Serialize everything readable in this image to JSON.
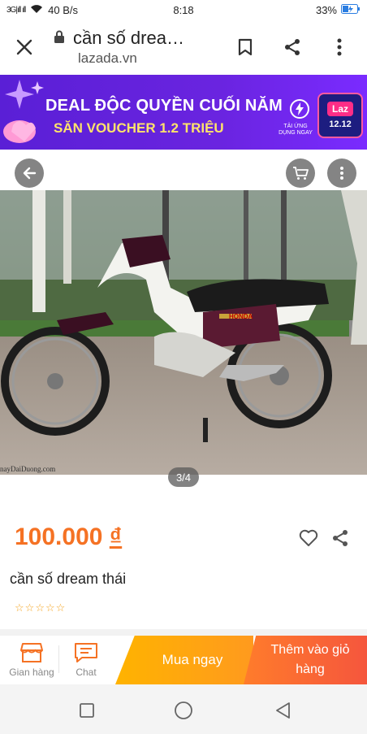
{
  "status_bar": {
    "signal_text": "3G|ıll ıll",
    "speed": "40 B/s",
    "time": "8:18",
    "battery": "33%"
  },
  "browser": {
    "tab_title": "cần số drea…",
    "domain": "lazada.vn",
    "icons": [
      "close-icon",
      "lock-icon",
      "bookmark-icon",
      "share-icon",
      "more-vert-icon"
    ]
  },
  "banner": {
    "line1": "DEAL ĐỘC QUYỀN CUỐI NĂM",
    "line2": "SĂN VOUCHER 1.2 TRIỆU",
    "cta": "TẢI ỨNG DỤNG NGAY",
    "brand": "Laz",
    "date": "12.12",
    "colors": {
      "background": "#6a24e0",
      "accent": "#ff2d87",
      "yellow": "#ffe36a"
    }
  },
  "gallery": {
    "watermark": "nayDaiDuong.com",
    "counter": "3/4",
    "image_brand_text": "HONDA"
  },
  "product": {
    "price_value": "100.000",
    "price_currency": "₫",
    "title": "cần số dream thái",
    "rating_stars": 0,
    "max_stars": 5,
    "price_color": "#f57224"
  },
  "bottom_bar": {
    "store_label": "Gian hàng",
    "chat_label": "Chat",
    "buy_now_label": "Mua ngay",
    "add_to_cart_label": "Thêm vào giỏ hàng"
  },
  "system_nav": {
    "icons": [
      "recent-apps-icon",
      "home-icon",
      "back-icon"
    ]
  }
}
